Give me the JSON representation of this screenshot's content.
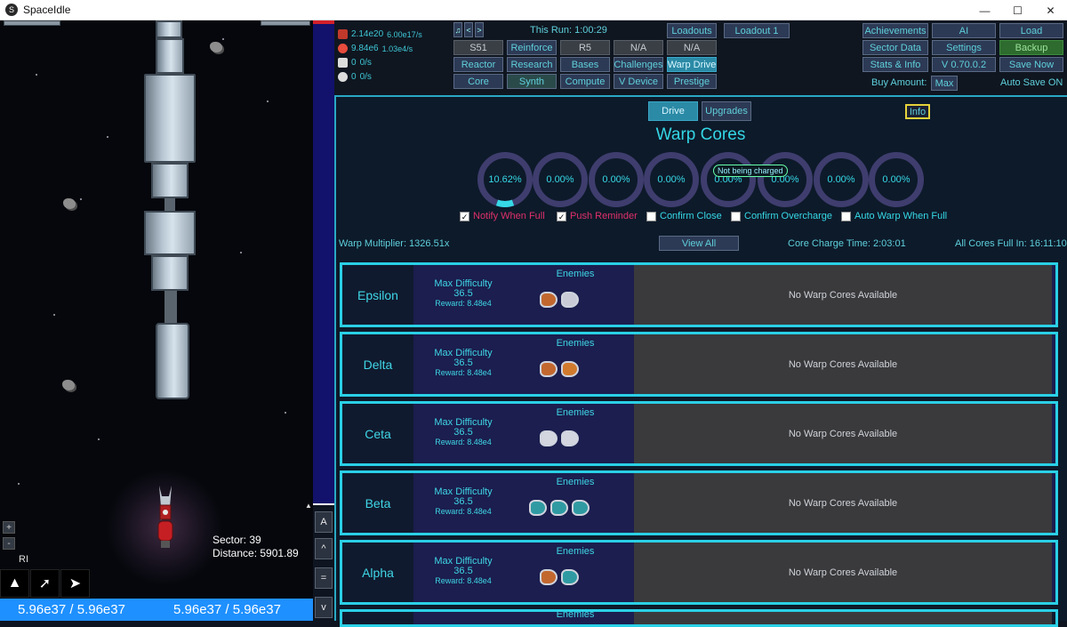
{
  "window": {
    "title": "SpaceIdle",
    "icon": "spaceidle-logo-icon"
  },
  "game": {
    "sector_label": "Sector: 39",
    "distance_label": "Distance: 5901.89",
    "ship_tag": "RI",
    "zoom_in": "+",
    "zoom_out": "-",
    "hp_left": "5.96e37 / 5.96e37",
    "hp_right": "5.96e37 / 5.96e37",
    "side_buttons": [
      "A",
      "^",
      "=",
      "v"
    ]
  },
  "resources": [
    {
      "value": "2.14e20",
      "rate": "6.00e17/s",
      "icon": "scrap-icon",
      "color": "#c0392b"
    },
    {
      "value": "9.84e6",
      "rate": "1.03e4/s",
      "icon": "energy-orb-icon",
      "color": "#e74c3c"
    },
    {
      "value": "0",
      "rate": "0/s",
      "icon": "database-icon",
      "color": "#dddddd"
    },
    {
      "value": "0",
      "rate": "0/s",
      "icon": "core-sphere-icon",
      "color": "#dddddd"
    }
  ],
  "topbar": {
    "this_run": "This Run: 1:00:29",
    "nav_prev": "<",
    "nav_next": ">",
    "row1": {
      "s51": "S51",
      "reinforce": "Reinforce",
      "r5": "R5",
      "na1": "N/A",
      "na2": "N/A"
    },
    "row2": {
      "reactor": "Reactor",
      "research": "Research",
      "bases": "Bases",
      "challenges": "Challenges",
      "warp_drive": "Warp Drive"
    },
    "row3": {
      "core": "Core",
      "synth": "Synth",
      "compute": "Compute",
      "v_device": "V Device",
      "prestige": "Prestige"
    },
    "loadouts": "Loadouts",
    "loadout1": "Loadout 1",
    "achievements": "Achievements",
    "ai": "AI",
    "load": "Load",
    "sector_data": "Sector Data",
    "settings": "Settings",
    "backup": "Backup",
    "stats_info": "Stats & Info",
    "version": "V 0.70.0.2",
    "save_now": "Save Now",
    "buy_amount_label": "Buy Amount:",
    "buy_amount_value": "Max",
    "auto_save": "Auto Save ON"
  },
  "warp": {
    "tab_drive": "Drive",
    "tab_upgrades": "Upgrades",
    "info": "Info",
    "title": "Warp Cores",
    "cores": [
      "10.62%",
      "0.00%",
      "0.00%",
      "0.00%",
      "0.00%",
      "0.00%",
      "0.00%",
      "0.00%"
    ],
    "core1_fill": 0.1062,
    "tooltip": "Not being charged",
    "options": [
      {
        "label": "Notify When Full",
        "checked": true,
        "color": "#e0306a"
      },
      {
        "label": "Push Reminder",
        "checked": true,
        "color": "#e0306a"
      },
      {
        "label": "Confirm Close",
        "checked": false,
        "color": "#36d9e6"
      },
      {
        "label": "Confirm Overcharge",
        "checked": false,
        "color": "#36d9e6"
      },
      {
        "label": "Auto Warp When Full",
        "checked": false,
        "color": "#36d9e6"
      }
    ],
    "multiplier": "Warp Multiplier: 1326.51x",
    "view_all": "View All",
    "charge_time": "Core Charge Time: 2:03:01",
    "all_full": "All Cores Full In: 16:11:10",
    "sectors": [
      {
        "name": "Epsilon",
        "md_label": "Max Difficulty",
        "md_value": "36.5",
        "reward": "Reward: 8.48e4",
        "enemies_label": "Enemies",
        "enemy_colors": [
          "#c2682f",
          "#c9ccd6"
        ],
        "status": "No Warp Cores Available"
      },
      {
        "name": "Delta",
        "md_label": "Max Difficulty",
        "md_value": "36.5",
        "reward": "Reward: 8.48e4",
        "enemies_label": "Enemies",
        "enemy_colors": [
          "#c2682f",
          "#d07a2e"
        ],
        "status": "No Warp Cores Available"
      },
      {
        "name": "Ceta",
        "md_label": "Max Difficulty",
        "md_value": "36.5",
        "reward": "Reward: 8.48e4",
        "enemies_label": "Enemies",
        "enemy_colors": [
          "#d3d6de",
          "#d3d6de"
        ],
        "status": "No Warp Cores Available"
      },
      {
        "name": "Beta",
        "md_label": "Max Difficulty",
        "md_value": "36.5",
        "reward": "Reward: 8.48e4",
        "enemies_label": "Enemies",
        "enemy_colors": [
          "#2f9aa2",
          "#2f9aa2",
          "#2f9aa2"
        ],
        "status": "No Warp Cores Available"
      },
      {
        "name": "Alpha",
        "md_label": "Max Difficulty",
        "md_value": "36.5",
        "reward": "Reward: 8.48e4",
        "enemies_label": "Enemies",
        "enemy_colors": [
          "#c2682f",
          "#2f9aa2"
        ],
        "status": "No Warp Cores Available"
      }
    ],
    "partial_label": "Enemies"
  }
}
